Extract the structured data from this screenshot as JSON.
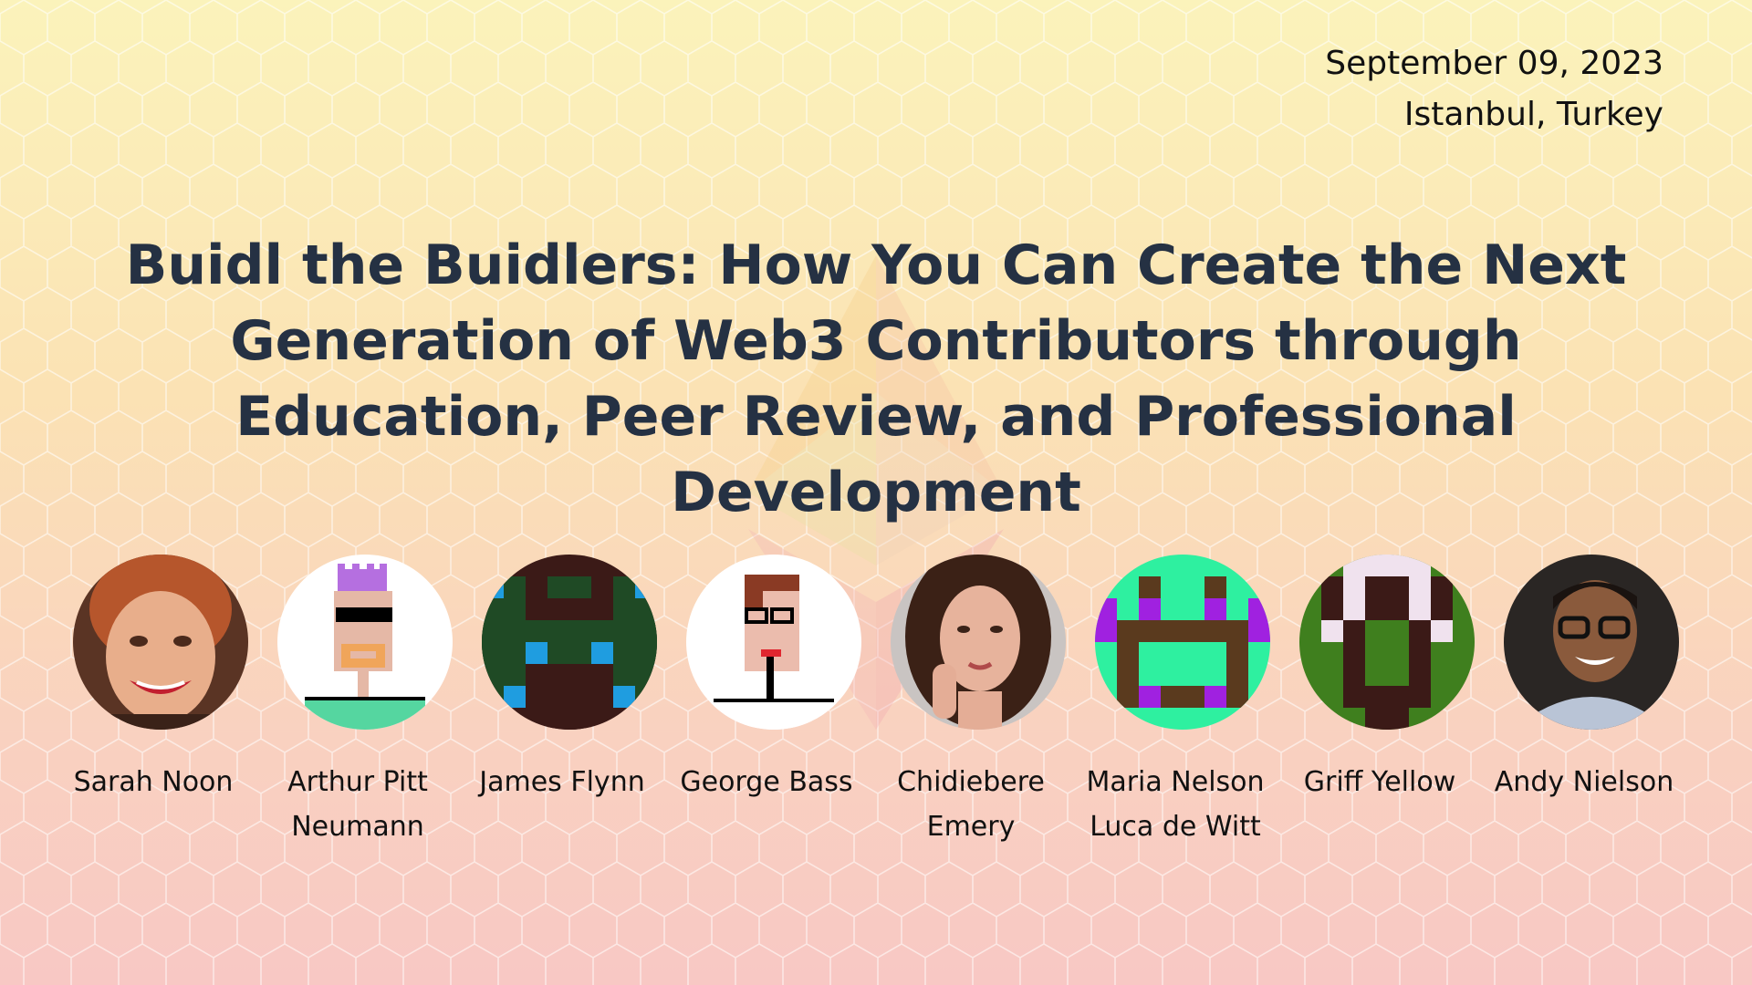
{
  "event": {
    "date": "September 09, 2023",
    "location": "Istanbul, Turkey"
  },
  "title": "Buidl the Buidlers: How You Can Create the Next Generation of Web3 Contributors through Education, Peer Review, and Professional Development",
  "colors": {
    "title": "#253143",
    "background_top": "#fbf3bb",
    "background_bottom": "#f8c8c4"
  },
  "background_icon": "ethereum-logo-watermark",
  "speakers": [
    {
      "name": "Sarah Noon",
      "avatar": "photo-woman-red-hair"
    },
    {
      "name": "Arthur Pitt Neumann",
      "avatar": "pixel-punk-sunglasses"
    },
    {
      "name": "James Flynn",
      "avatar": "pixel-pattern-green-blue"
    },
    {
      "name": "George Bass",
      "avatar": "pixel-punk-glasses"
    },
    {
      "name": "Chidiebere Emery",
      "avatar": "photo-woman-brown-hair"
    },
    {
      "name": "Maria Nelson Luca de Witt",
      "avatar": "pixel-pattern-mint-purple"
    },
    {
      "name": "Griff Yellow",
      "avatar": "pixel-pattern-green-white"
    },
    {
      "name": "Andy Nielson",
      "avatar": "photo-man-glasses"
    }
  ]
}
